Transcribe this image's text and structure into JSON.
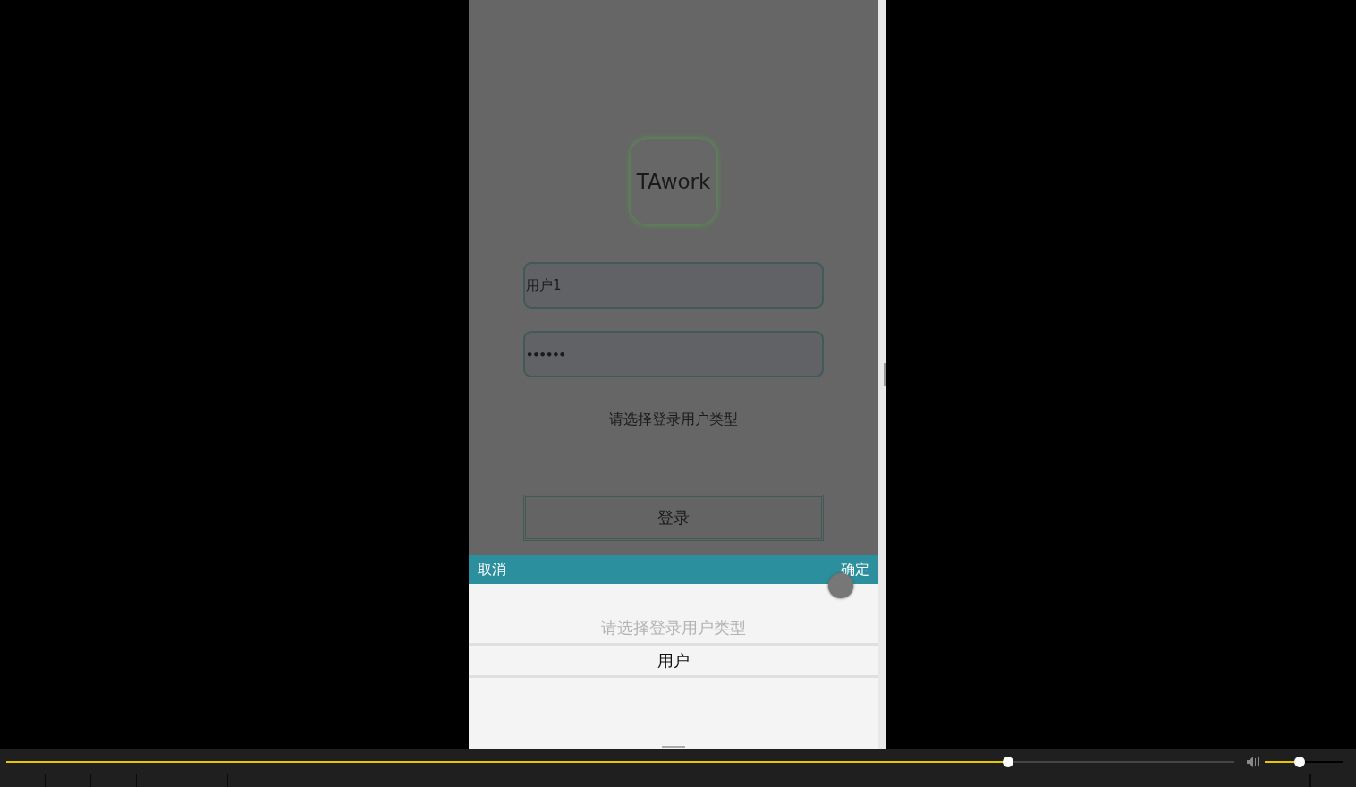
{
  "login": {
    "logo": "TAwork",
    "username": {
      "value": "用户1"
    },
    "password": {
      "value": "••••••"
    },
    "user_type_label": "请选择登录用户类型",
    "login_button": "登录"
  },
  "picker": {
    "cancel": "取消",
    "confirm": "确定",
    "title": "请选择登录用户类型",
    "options": [
      {
        "label": "用户",
        "selected": true
      }
    ]
  },
  "player": {
    "seek": {
      "level": 0.816
    },
    "volume": {
      "level": 0.44
    }
  }
}
